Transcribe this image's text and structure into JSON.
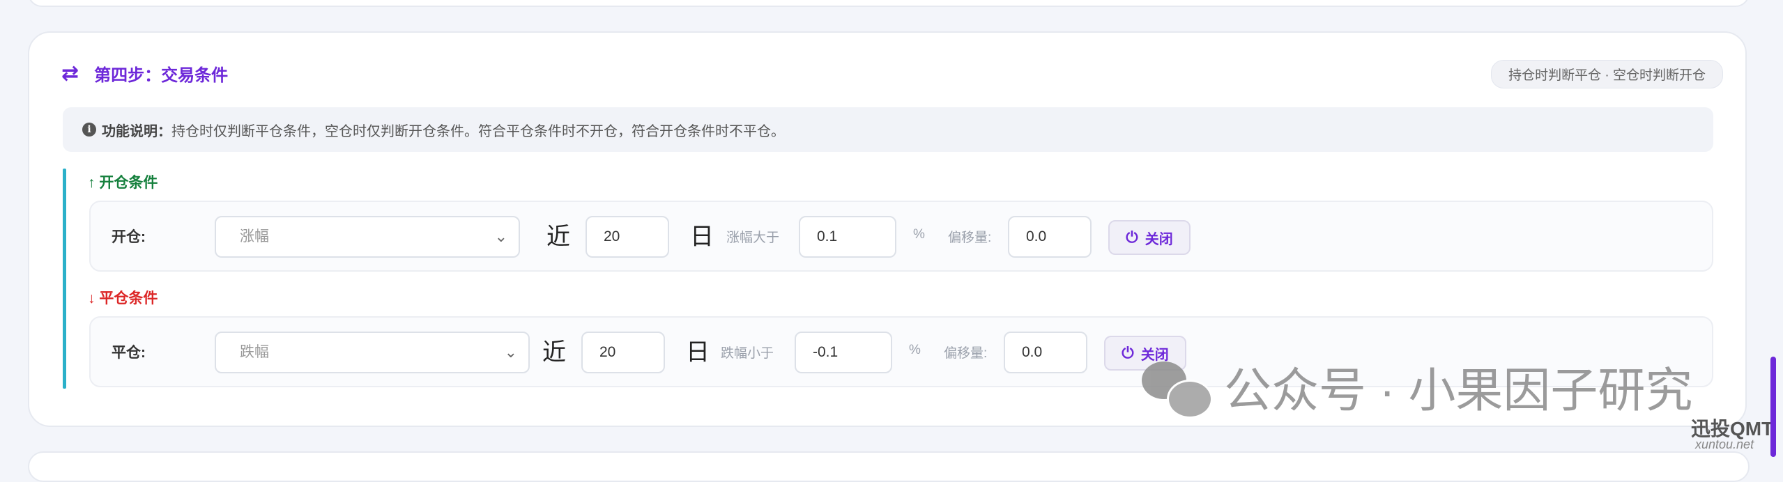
{
  "step": {
    "title": "第四步：交易条件",
    "icon": "swap-arrows-icon",
    "badge": "持仓时判断平仓 · 空仓时判断开仓"
  },
  "info": {
    "label": "功能说明：",
    "text": "持仓时仅判断平仓条件，空仓时仅判断开仓条件。符合平仓条件时不开仓，符合开仓条件时不平仓。"
  },
  "open": {
    "section_label": "↑ 开仓条件",
    "row_label": "开仓:",
    "indicator": "涨幅",
    "near": "近",
    "days": "20",
    "day_unit": "日",
    "cond_label": "涨幅大于",
    "threshold": "0.1",
    "percent": "%",
    "offset_label": "偏移量:",
    "offset": "0.0",
    "toggle_label": "关闭"
  },
  "close": {
    "section_label": "↓ 平仓条件",
    "row_label": "平仓:",
    "indicator": "跌幅",
    "near": "近",
    "days": "20",
    "day_unit": "日",
    "cond_label": "跌幅小于",
    "threshold": "-0.1",
    "percent": "%",
    "offset_label": "偏移量:",
    "offset": "0.0",
    "toggle_label": "关闭"
  },
  "watermark": {
    "text": "公众号 · 小果因子研究",
    "logo": "迅投QMT",
    "logo_sub": "xuntou.net"
  },
  "colors": {
    "accent": "#6d28d9",
    "open_green": "#15803d",
    "close_red": "#dc2626",
    "section_bar": "#2bb0c9"
  }
}
